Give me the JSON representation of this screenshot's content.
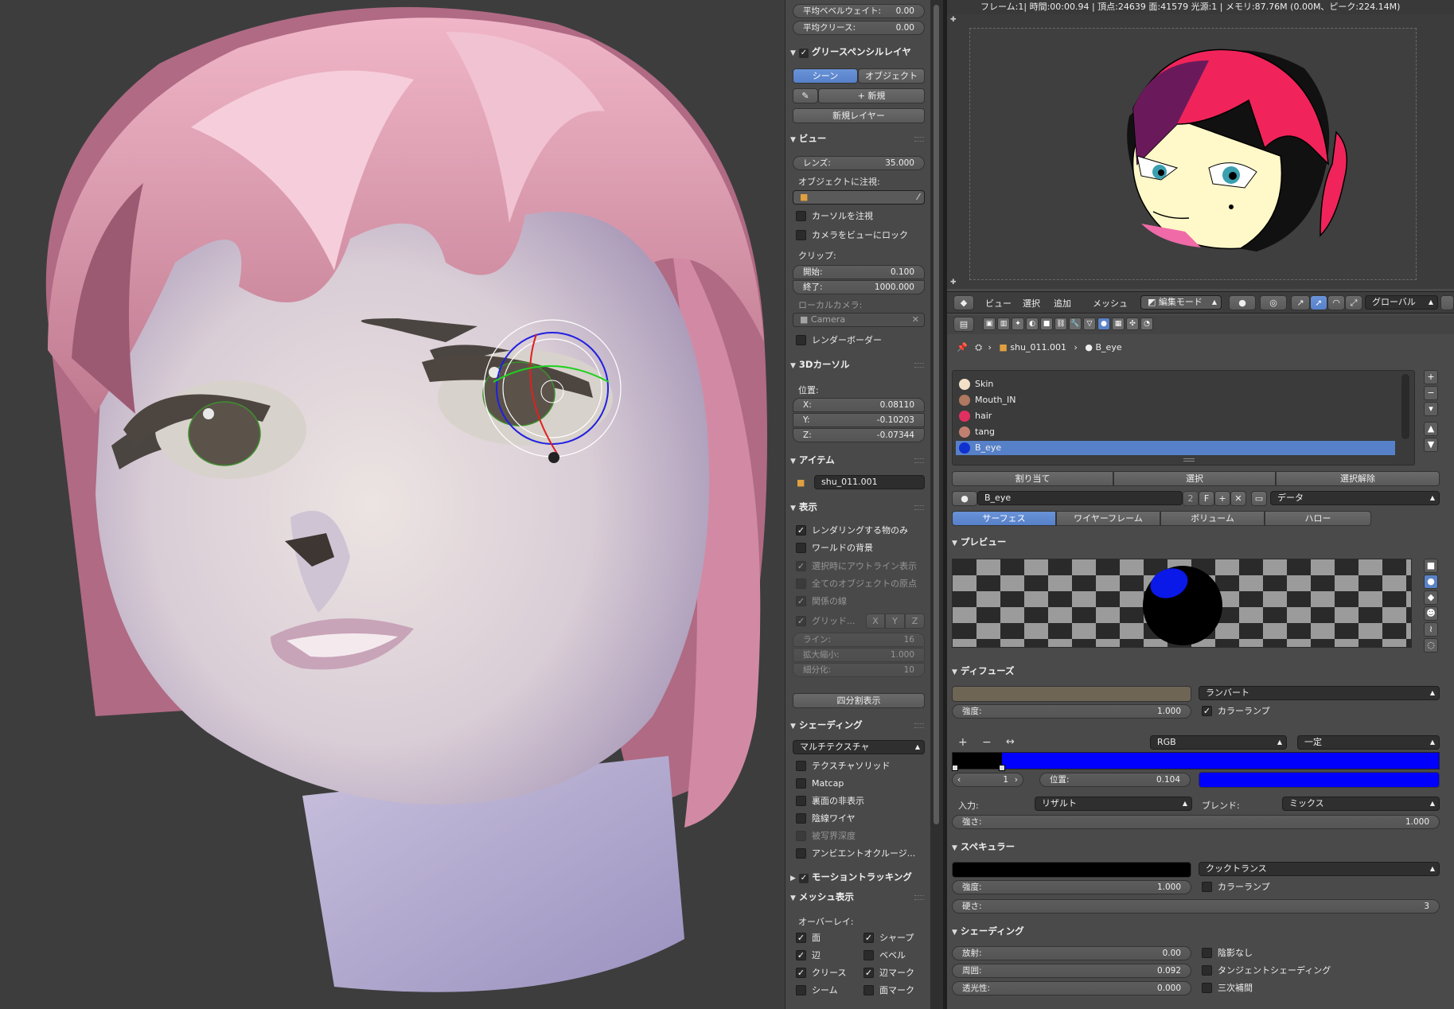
{
  "status": "フレーム:1| 時間:00:00.94 | 頂点:24639 面:41579 光源:1 | メモリ:87.76M (0.00M、ピーク:224.14M)",
  "npanel": {
    "bevel_weight_label": "平均ベベルウェイト:",
    "bevel_weight_value": "0.00",
    "crease_label": "平均クリース:",
    "crease_value": "0.00",
    "grease_title": "グリースペンシルレイヤ",
    "scene_tab": "シーン",
    "object_tab": "オブジェクト",
    "new_label": "新規",
    "new_layer_label": "新規レイヤー",
    "view_title": "ビュー",
    "lens_label": "レンズ:",
    "lens_value": "35.000",
    "lock_object_label": "オブジェクトに注視:",
    "lock_cursor_label": "カーソルを注視",
    "lock_camera_label": "カメラをビューにロック",
    "clip_label": "クリップ:",
    "clip_start_label": "開始:",
    "clip_start_value": "0.100",
    "clip_end_label": "終了:",
    "clip_end_value": "1000.000",
    "local_camera_label": "ローカルカメラ:",
    "local_camera_value": "Camera",
    "render_border_label": "レンダーボーダー",
    "cursor_title": "3Dカーソル",
    "location_label": "位置:",
    "x_label": "X:",
    "x_value": "0.08110",
    "y_label": "Y:",
    "y_value": "-0.10203",
    "z_label": "Z:",
    "z_value": "-0.07344",
    "item_title": "アイテム",
    "item_name": "shu_011.001",
    "display_title": "表示",
    "only_render_label": "レンダリングする物のみ",
    "world_bg_label": "ワールドの背景",
    "outline_sel_label": "選択時にアウトライン表示",
    "all_origins_label": "全てのオブジェクトの原点",
    "relationship_label": "関係の線",
    "grid_floor_label": "グリッド...",
    "axis_x": "X",
    "axis_y": "Y",
    "axis_z": "Z",
    "lines_label": "ライン:",
    "lines_value": "16",
    "scale_label": "拡大縮小:",
    "scale_value": "1.000",
    "subdiv_label": "細分化:",
    "subdiv_value": "10",
    "quad_view_label": "四分割表示",
    "shading_title": "シェーディング",
    "shading_mode": "マルチテクスチャ",
    "tex_solid_label": "テクスチャソリッド",
    "matcap_label": "Matcap",
    "backface_label": "裏面の非表示",
    "hidden_wire_label": "陰線ワイヤ",
    "dof_label": "被写界深度",
    "ao_label": "アンビエントオクルージ...",
    "motion_track_title": "モーショントラッキング",
    "mesh_display_title": "メッシュ表示",
    "overlay_label": "オーバーレイ:",
    "faces_label": "面",
    "sharp_label": "シャープ",
    "edges_label": "辺",
    "bevel_label": "ベベル",
    "crease2_label": "クリース",
    "edge_marks_label": "辺マーク",
    "seams_label": "シーム",
    "face_marks_label": "面マーク"
  },
  "header3d": {
    "view_menu": "ビュー",
    "select_menu": "選択",
    "add_menu": "追加",
    "mesh_menu": "メッシュ",
    "mode": "編集モード",
    "orientation": "グローバル"
  },
  "breadcrumb": {
    "object": "shu_011.001",
    "material": "B_eye"
  },
  "materials": [
    {
      "name": "Skin",
      "color": "#f3e0c8"
    },
    {
      "name": "Mouth_IN",
      "color": "#b07860"
    },
    {
      "name": "hair",
      "color": "#e03060"
    },
    {
      "name": "tang",
      "color": "#c08070"
    },
    {
      "name": "B_eye",
      "color": "#1030d0"
    }
  ],
  "material_actions": {
    "assign": "割り当て",
    "select": "選択",
    "deselect": "選択解除"
  },
  "material_field": {
    "name": "B_eye",
    "users": "2",
    "fake": "F",
    "link": "データ"
  },
  "material_tabs": [
    "サーフェス",
    "ワイヤーフレーム",
    "ボリューム",
    "ハロー"
  ],
  "preview_title": "プレビュー",
  "diffuse": {
    "title": "ディフューズ",
    "shader": "ランバート",
    "intensity_label": "強度:",
    "intensity_value": "1.000",
    "ramp_label": "カラーランプ",
    "ramp_mode": "RGB",
    "interp": "一定",
    "index_value": "1",
    "pos_label": "位置:",
    "pos_value": "0.104",
    "input_label": "入力:",
    "input_value": "リザルト",
    "blend_label": "ブレンド:",
    "blend_value": "ミックス",
    "factor_label": "強さ:",
    "factor_value": "1.000",
    "color": "#6e6555",
    "ramp_color": "#0000ff"
  },
  "specular": {
    "title": "スペキュラー",
    "shader": "クックトランス",
    "intensity_label": "強度:",
    "intensity_value": "1.000",
    "ramp_label": "カラーランプ",
    "hardness_label": "硬さ:",
    "hardness_value": "3"
  },
  "mat_shading": {
    "title": "シェーディング",
    "emit_label": "放射:",
    "emit_value": "0.00",
    "ambient_label": "周囲:",
    "ambient_value": "0.092",
    "translucency_label": "透光性:",
    "translucency_value": "0.000",
    "shadeless_label": "陰影なし",
    "tangent_label": "タンジェントシェーディング",
    "cubic_label": "三次補間"
  }
}
